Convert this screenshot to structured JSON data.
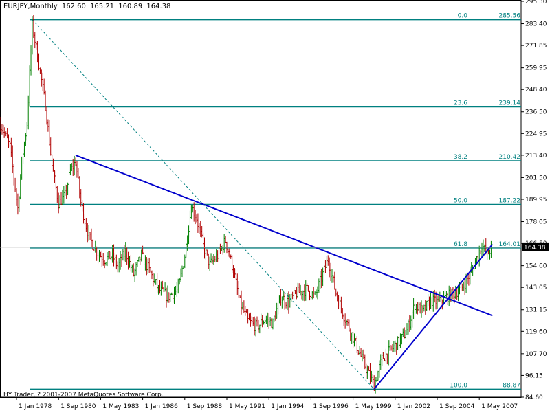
{
  "header": {
    "symbol_timeframe": "EURJPY,Monthly",
    "open": "162.60",
    "high": "165.21",
    "low": "160.89",
    "close": "164.38"
  },
  "footer": {
    "copyright": "HY Trader, ? 2001-2007 MetaQuotes Software Corp."
  },
  "colors": {
    "up": "#008000",
    "down": "#b00000",
    "fibo": "#008080",
    "trend": "#0000cc",
    "axis": "#000000",
    "badge_bg": "#000000",
    "badge_text": "#ffffff"
  },
  "chart_data": {
    "type": "candlestick",
    "title": "",
    "xlabel": "",
    "ylabel": "",
    "grid": false,
    "ylim": [
      84.6,
      295.3
    ],
    "y_ticks": [
      "295.30",
      "283.40",
      "271.85",
      "259.95",
      "248.40",
      "236.50",
      "224.95",
      "213.40",
      "201.50",
      "189.95",
      "178.05",
      "166.50",
      "154.60",
      "143.05",
      "131.15",
      "119.60",
      "107.70",
      "96.15",
      "84.60"
    ],
    "x_ticks": [
      "1 Jan 1978",
      "1 Sep 1980",
      "1 May 1983",
      "1 Jan 1986",
      "1 Sep 1988",
      "1 May 1991",
      "1 Jan 1994",
      "1 Sep 1996",
      "1 May 1999",
      "1 Jan 2002",
      "1 Sep 2004",
      "1 May 2007"
    ],
    "current_price": "164.38",
    "fibonacci_levels": [
      {
        "level": "0.0",
        "price": "285.56"
      },
      {
        "level": "23.6",
        "price": "239.14"
      },
      {
        "level": "38.2",
        "price": "210.42"
      },
      {
        "level": "50.0",
        "price": "187.22"
      },
      {
        "level": "61.8",
        "price": "164.01"
      },
      {
        "level": "100.0",
        "price": "88.87"
      }
    ],
    "trendlines": [
      {
        "from": [
          "1981-10",
          213.4
        ],
        "to": [
          "2008-03",
          128.0
        ],
        "style": "solid"
      },
      {
        "from": [
          "2000-09",
          88.87
        ],
        "to": [
          "2008-03",
          166.0
        ],
        "style": "solid"
      },
      {
        "from": [
          "1979-01",
          285.56
        ],
        "to": [
          "2000-09",
          88.87
        ],
        "style": "dashed"
      }
    ],
    "anchors": [
      {
        "date": "1977-01",
        "price": 230
      },
      {
        "date": "1977-08",
        "price": 218
      },
      {
        "date": "1978-02",
        "price": 185
      },
      {
        "date": "1978-05",
        "price": 210
      },
      {
        "date": "1978-09",
        "price": 230
      },
      {
        "date": "1979-01",
        "price": 283
      },
      {
        "date": "1979-06",
        "price": 262
      },
      {
        "date": "1979-11",
        "price": 240
      },
      {
        "date": "1980-04",
        "price": 208
      },
      {
        "date": "1980-09",
        "price": 188
      },
      {
        "date": "1981-02",
        "price": 192
      },
      {
        "date": "1981-06",
        "price": 205
      },
      {
        "date": "1981-10",
        "price": 210
      },
      {
        "date": "1982-02",
        "price": 188
      },
      {
        "date": "1982-08",
        "price": 170
      },
      {
        "date": "1983-02",
        "price": 162
      },
      {
        "date": "1983-08",
        "price": 158
      },
      {
        "date": "1984-02",
        "price": 160
      },
      {
        "date": "1984-06",
        "price": 154
      },
      {
        "date": "1984-12",
        "price": 162
      },
      {
        "date": "1985-06",
        "price": 150
      },
      {
        "date": "1985-12",
        "price": 160
      },
      {
        "date": "1986-06",
        "price": 152
      },
      {
        "date": "1987-01",
        "price": 142
      },
      {
        "date": "1987-08",
        "price": 138
      },
      {
        "date": "1988-04",
        "price": 142
      },
      {
        "date": "1988-09",
        "price": 160
      },
      {
        "date": "1989-02",
        "price": 186
      },
      {
        "date": "1989-06",
        "price": 180
      },
      {
        "date": "1989-11",
        "price": 165
      },
      {
        "date": "1990-04",
        "price": 155
      },
      {
        "date": "1990-10",
        "price": 160
      },
      {
        "date": "1991-04",
        "price": 168
      },
      {
        "date": "1991-10",
        "price": 152
      },
      {
        "date": "1992-03",
        "price": 135
      },
      {
        "date": "1992-09",
        "price": 125
      },
      {
        "date": "1993-04",
        "price": 122
      },
      {
        "date": "1993-10",
        "price": 126
      },
      {
        "date": "1994-04",
        "price": 124
      },
      {
        "date": "1994-10",
        "price": 138
      },
      {
        "date": "1995-04",
        "price": 135
      },
      {
        "date": "1995-10",
        "price": 140
      },
      {
        "date": "1996-06",
        "price": 142
      },
      {
        "date": "1996-12",
        "price": 138
      },
      {
        "date": "1997-06",
        "price": 150
      },
      {
        "date": "1997-10",
        "price": 158
      },
      {
        "date": "1998-04",
        "price": 140
      },
      {
        "date": "1998-10",
        "price": 128
      },
      {
        "date": "1999-04",
        "price": 118
      },
      {
        "date": "1999-10",
        "price": 108
      },
      {
        "date": "2000-04",
        "price": 98
      },
      {
        "date": "2000-09",
        "price": 91
      },
      {
        "date": "2001-03",
        "price": 105
      },
      {
        "date": "2001-10",
        "price": 110
      },
      {
        "date": "2002-04",
        "price": 114
      },
      {
        "date": "2002-10",
        "price": 120
      },
      {
        "date": "2003-04",
        "price": 134
      },
      {
        "date": "2003-10",
        "price": 130
      },
      {
        "date": "2004-04",
        "price": 136
      },
      {
        "date": "2004-10",
        "price": 135
      },
      {
        "date": "2005-04",
        "price": 138
      },
      {
        "date": "2005-10",
        "price": 140
      },
      {
        "date": "2006-04",
        "price": 143
      },
      {
        "date": "2006-10",
        "price": 150
      },
      {
        "date": "2007-04",
        "price": 160
      },
      {
        "date": "2007-07",
        "price": 166
      },
      {
        "date": "2007-11",
        "price": 160
      },
      {
        "date": "2008-02",
        "price": 164
      }
    ]
  }
}
